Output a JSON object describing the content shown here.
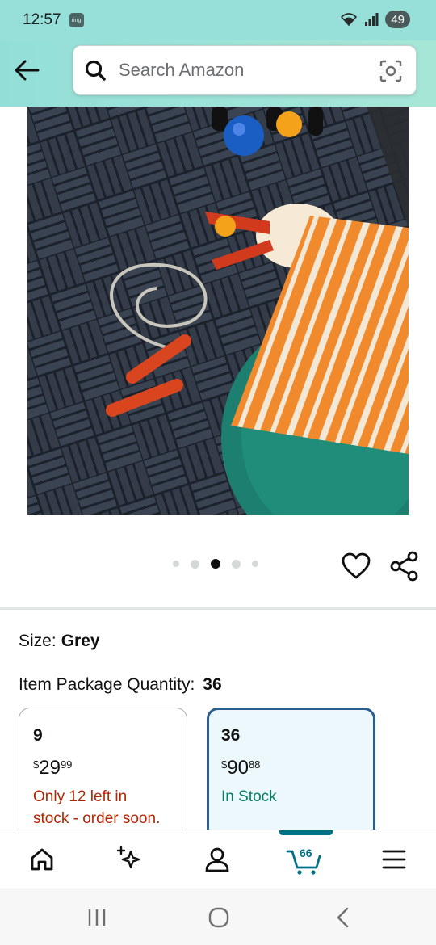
{
  "status_bar": {
    "time": "12:57",
    "notification_label": "ring",
    "battery": "49"
  },
  "search": {
    "placeholder": "Search Amazon"
  },
  "product": {
    "carousel_total": 5,
    "carousel_active_index": 2
  },
  "options": {
    "size_label": "Size:",
    "size_value": "Grey",
    "quantity_label": "Item Package Quantity:",
    "quantity_value": "36",
    "cards": [
      {
        "title": "9",
        "currency": "$",
        "price_whole": "29",
        "price_fraction": "99",
        "stock_line1": "Only 12 left in",
        "stock_line2": "stock - order soon.",
        "selected": false
      },
      {
        "title": "36",
        "currency": "$",
        "price_whole": "90",
        "price_fraction": "88",
        "stock_line1": "In Stock",
        "selected": true
      }
    ]
  },
  "bottom_nav": {
    "items": [
      "home-icon",
      "sparkle-icon",
      "account-icon",
      "cart-icon",
      "menu-icon"
    ],
    "cart_count": "66"
  },
  "colors": {
    "header_bg": "#97e0d9",
    "selected_border": "#2b5d8f",
    "selected_bg": "#ecf8fc",
    "stock_warning": "#b12704",
    "in_stock": "#067d62",
    "accent": "#007185"
  }
}
